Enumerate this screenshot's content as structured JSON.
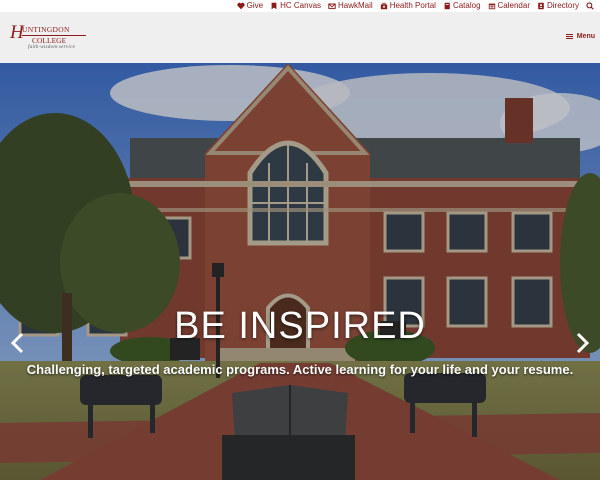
{
  "utility_nav": {
    "links": [
      {
        "label": "Give",
        "icon": "heart-icon"
      },
      {
        "label": "HC Canvas",
        "icon": "bookmark-icon"
      },
      {
        "label": "HawkMail",
        "icon": "envelope-icon"
      },
      {
        "label": "Health Portal",
        "icon": "medical-kit-icon"
      },
      {
        "label": "Catalog",
        "icon": "book-icon"
      },
      {
        "label": "Calendar",
        "icon": "calendar-icon"
      },
      {
        "label": "Directory",
        "icon": "address-book-icon"
      }
    ],
    "search_icon": "search-icon"
  },
  "header": {
    "logo": {
      "name_top": "UNTINGDON",
      "initial": "H",
      "name_bottom": "COLLEGE",
      "tagline": "faith·wisdom·service"
    },
    "menu_label": "Menu"
  },
  "hero": {
    "headline": "BE INSPIRED",
    "subheadline": "Challenging, targeted academic programs. Active learning for your life and your resume."
  },
  "colors": {
    "brand": "#8b1a1a",
    "header_bg": "#efefef",
    "hero_text": "#ffffff"
  }
}
